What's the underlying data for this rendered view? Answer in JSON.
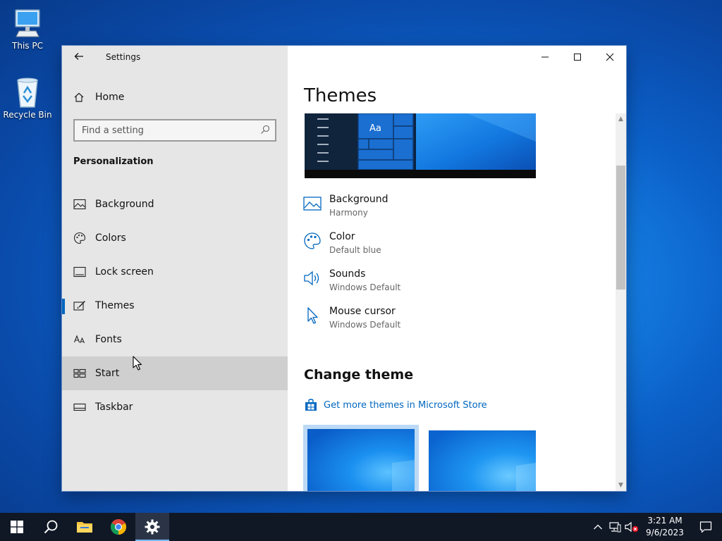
{
  "desktop": {
    "icons": [
      {
        "label": "This PC"
      },
      {
        "label": "Recycle Bin"
      }
    ]
  },
  "window": {
    "title": "Settings",
    "sidebar": {
      "home_label": "Home",
      "search_placeholder": "Find a setting",
      "section_label": "Personalization",
      "items": [
        {
          "label": "Background",
          "icon": "image-icon"
        },
        {
          "label": "Colors",
          "icon": "palette-icon"
        },
        {
          "label": "Lock screen",
          "icon": "lock-screen-icon"
        },
        {
          "label": "Themes",
          "icon": "brush-icon",
          "active": true
        },
        {
          "label": "Fonts",
          "icon": "font-icon"
        },
        {
          "label": "Start",
          "icon": "start-layout-icon",
          "hover": true
        },
        {
          "label": "Taskbar",
          "icon": "taskbar-icon"
        }
      ]
    },
    "content": {
      "title": "Themes",
      "preview_sample_text": "Aa",
      "properties": [
        {
          "label": "Background",
          "value": "Harmony",
          "icon": "image-icon"
        },
        {
          "label": "Color",
          "value": "Default blue",
          "icon": "palette-icon"
        },
        {
          "label": "Sounds",
          "value": "Windows Default",
          "icon": "speaker-icon"
        },
        {
          "label": "Mouse cursor",
          "value": "Windows Default",
          "icon": "cursor-icon"
        }
      ],
      "change_theme_heading": "Change theme",
      "store_link": "Get more themes in Microsoft Store"
    }
  },
  "taskbar": {
    "clock_time": "3:21 AM",
    "clock_date": "9/6/2023"
  },
  "colors": {
    "accent": "#0067c0",
    "sidebar_bg": "#e6e6e6",
    "taskbar_bg": "#101826"
  }
}
